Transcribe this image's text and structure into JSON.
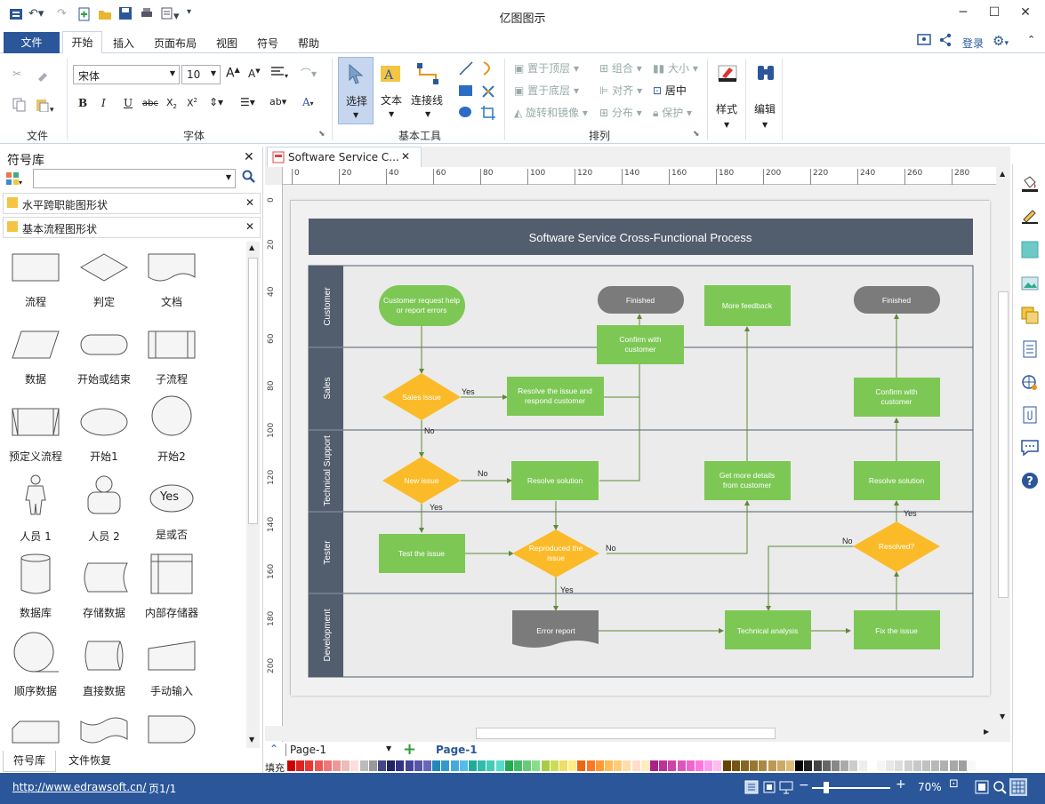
{
  "app": {
    "title": "亿图图示"
  },
  "menu": {
    "file": "文件",
    "tabs": [
      "开始",
      "插入",
      "页面布局",
      "视图",
      "符号",
      "帮助"
    ],
    "login": "登录"
  },
  "ribbon": {
    "groups": {
      "file": "文件",
      "font": "字体",
      "basic_tools": "基本工具",
      "arrange": "排列"
    },
    "font_name": "宋体",
    "font_size": "10",
    "tools": {
      "select": "选择",
      "text": "文本",
      "connector": "连接线"
    },
    "arrange": {
      "bring_front": "置于顶层",
      "send_back": "置于底层",
      "rotate": "旋转和镜像",
      "group": "组合",
      "align": "对齐",
      "distribute": "分布",
      "size": "大小",
      "center": "居中",
      "protect": "保护"
    },
    "style": "样式",
    "edit": "编辑"
  },
  "library": {
    "title": "符号库",
    "categories": [
      "水平跨职能图形状",
      "基本流程图形状"
    ],
    "shapes": [
      "流程",
      "判定",
      "文档",
      "数据",
      "开始或结束",
      "子流程",
      "预定义流程",
      "开始1",
      "开始2",
      "人员 1",
      "人员 2",
      "是或否",
      "数据库",
      "存储数据",
      "内部存储器",
      "顺序数据",
      "直接数据",
      "手动输入"
    ],
    "yes_label": "Yes",
    "tabs": [
      "符号库",
      "文件恢复"
    ]
  },
  "document": {
    "tab": "Software Service C...",
    "ruler_h": [
      "0",
      "20",
      "40",
      "60",
      "80",
      "100",
      "120",
      "140",
      "160",
      "180",
      "200",
      "220",
      "240",
      "260",
      "280"
    ],
    "ruler_v": [
      "0",
      "20",
      "40",
      "60",
      "80",
      "100",
      "120",
      "140",
      "160",
      "180",
      "200"
    ]
  },
  "diagram": {
    "title": "Software Service Cross-Functional Process",
    "lanes": [
      "Customer",
      "Sales",
      "Technical Support",
      "Tester",
      "Development"
    ],
    "nodes": {
      "customer_request": "Customer request help or report errors",
      "finished1": "Finished",
      "more_feedback": "More feedback",
      "finished2": "Finished",
      "confirm1": "Confirm with customer",
      "sales_issue": "Sales issue",
      "resolve_issue": "Resolve the issue and respond customer",
      "confirm2": "Confirm with customer",
      "new_issue": "New issue",
      "resolve_solution1": "Resolve solution",
      "get_details": "Get more details from customer",
      "resolve_solution2": "Resolve solution",
      "test_issue": "Test the issue",
      "reproduced": "Reproduced the issue",
      "resolved": "Resolved?",
      "error_report": "Error report",
      "tech_analysis": "Technical analysis",
      "fix_issue": "Fix the issue"
    },
    "labels": {
      "yes": "Yes",
      "no": "No"
    }
  },
  "pages": {
    "current": "Page-1",
    "tab": "Page-1"
  },
  "fill_label": "填充",
  "status": {
    "url": "http://www.edrawsoft.cn/",
    "page": "页1/1",
    "zoom": "70%"
  },
  "colors": {
    "accent": "#2b579a",
    "green": "#7dc855",
    "yellow": "#fbbb28",
    "lane": "#525e6e",
    "gray_node": "#7b7b7b"
  }
}
